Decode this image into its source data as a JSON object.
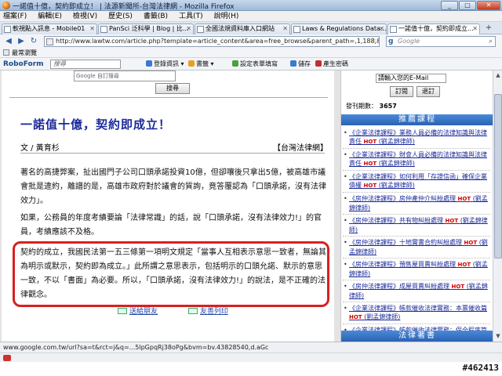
{
  "window": {
    "title": "一諾值十億，契約即成立！ | 法源新聞所-台灣法律網 - Mozilla Firefox",
    "controls": [
      "_",
      "□",
      "✕"
    ]
  },
  "menu": [
    "檔案(F)",
    "編輯(E)",
    "檢視(V)",
    "歷史(S)",
    "書籤(B)",
    "工具(T)",
    "說明(H)"
  ],
  "tabs": [
    {
      "label": "軟視點入訊息 - Mobile01",
      "active": false
    },
    {
      "label": "PanSci 泛科學 | Blog | 比...",
      "active": false
    },
    {
      "label": "全國法規資料庫入口網站",
      "active": false
    },
    {
      "label": "Laws & Regulations Data...",
      "active": false
    },
    {
      "label": "一諾值十億，契約即成立...",
      "active": true
    }
  ],
  "nav": {
    "url": "http://www.lawtw.com/article.php?template=article_content&area=free_browse&parent_path=,1,188,&job_id=8565C",
    "search_placeholder": "Google"
  },
  "bookmarks": {
    "label": "最常瀏覽"
  },
  "roboform": {
    "logo": "RoboForm",
    "search_placeholder": "搜尋",
    "items": [
      "登錄資訊",
      "書籤",
      "設定表單填寫",
      "儲存",
      "產生密碼"
    ]
  },
  "page": {
    "google_label": "Google 自訂搜尋",
    "search_button": "搜尋",
    "article": {
      "title": "一諾值十億，契約即成立！",
      "author": "文 / 黃育杉",
      "source": "【台灣法律網】",
      "paragraphs": [
        "著名的高捷弊案，扯出國門子公司口頭承諾投資10億，但卻嚷後只拿出5億，被高雄市議會批是違約，離譜的是，高雄市政府對於議會的質詢，竟答覆認為「口頭承諾，沒有法律效力」。",
        "如果，公務員的年度考績要論「法律常識」的話，說「口頭承諾，沒有法律效力!」的官員，考績應該不及格。",
        "契約的成立，我國民法第一五三條第一項明文規定「當事人互相表示意思一致者，無論其為明示或默示，契約即為成立。」此所謂之意思表示，包括明示的口頭允諾、默示的意思一致，不以「書面」為必要。所以，「口頭承諾，沒有法律效力!」的說法，是不正確的法律觀念。"
      ],
      "links": [
        "送給朋友",
        "友善列印"
      ]
    },
    "sidebar": {
      "subscribe_placeholder": "請輸入您的E-Mail",
      "subscribe_button": "訂閱",
      "unsubscribe_button": "退訂",
      "issue_label": "發刊期數：",
      "issue_number": "3657",
      "section_title": "推薦課程",
      "courses": [
        {
          "text": "《企業法律課程》業務人員必備的法律知識與法律責任",
          "hot": "HOT",
          "tail": "(劉孟錦律師)"
        },
        {
          "text": "《企業法律課程》財會人員必備的法律知識與法律責任",
          "hot": "HOT",
          "tail": "(劉孟錦律師)"
        },
        {
          "text": "《企業法律課程》如何利用「存證信函」確保企業債權",
          "hot": "HOT",
          "tail": "(劉孟錦律師)"
        },
        {
          "text": "《房仲法律課程》房仲產仲介糾紛處理",
          "hot": "HOT",
          "tail": "(劉孟錦律師)"
        },
        {
          "text": "《房仲法律課程》共有物糾紛處理",
          "hot": "HOT",
          "tail": "(劉孟錦律師)"
        },
        {
          "text": "《房仲法律課程》十地實書合約糾紛處理",
          "hot": "HOT",
          "tail": "(劉孟錦律師)"
        },
        {
          "text": "《房仲法律課程》預售屋買賣糾紛處理",
          "hot": "HOT",
          "tail": "(劉孟錦律師)"
        },
        {
          "text": "《房仲法律課程》成屋買賣糾紛處理",
          "hot": "HOT",
          "tail": "(劉孟錦律師)"
        },
        {
          "text": "《企業法律課程》帳款催收法律實務：本票催收篇",
          "hot": "HOT",
          "tail": "(劉孟錦律師)"
        },
        {
          "text": "《企業法律課程》帳款催收法律實務：保全程序篇（假扣押）",
          "hot": "HOT",
          "tail": "(劉孟錦律師)"
        }
      ],
      "section2_title": "法律著書"
    }
  },
  "status": {
    "text": "www.google.com.tw/url?sa=t&rct=j&q=...5lpGpqRj38oPg&bvm=bv.43828540,d.aGc"
  },
  "watermark": "#462413"
}
